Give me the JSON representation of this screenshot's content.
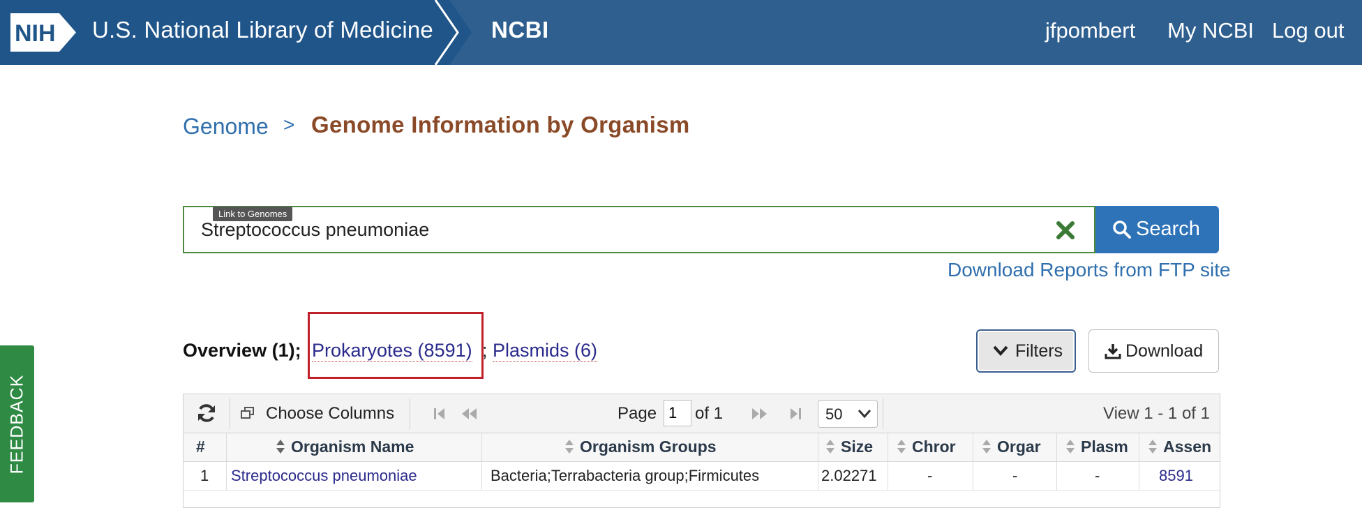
{
  "banner": {
    "nih_logo": "NIH",
    "nlm": "U.S. National Library of Medicine",
    "ncbi": "NCBI",
    "user": "jfpombert",
    "my_ncbi": "My NCBI",
    "logout": "Log out"
  },
  "breadcrumb": {
    "parent": "Genome",
    "separator": ">",
    "current": "Genome Information by Organism"
  },
  "search": {
    "value": "Streptococcus pneumoniae",
    "tooltip": "Link to Genomes",
    "button_label": "Search",
    "ftp_link": "Download Reports from FTP site"
  },
  "tabs": {
    "overview": "Overview (1);",
    "prokaryotes": "Prokaryotes (8591)",
    "sep": ";",
    "plasmids": "Plasmids (6)"
  },
  "actions": {
    "filters": "Filters",
    "download": "Download"
  },
  "toolbar": {
    "choose_columns": "Choose Columns",
    "page_label": "Page",
    "page_value": "1",
    "of_label": "of 1",
    "rows_per_page": "50",
    "view_range": "View 1 - 1 of 1"
  },
  "table": {
    "headers": {
      "num": "#",
      "organism_name": "Organism Name",
      "organism_groups": "Organism Groups",
      "size": "Size",
      "chromosomes": "Chror",
      "organelles": "Orgar",
      "plasmids": "Plasm",
      "assemblies": "Assen"
    },
    "rows": [
      {
        "num": "1",
        "organism_name": "Streptococcus pneumoniae",
        "organism_groups": "Bacteria;Terrabacteria group;Firmicutes",
        "size": "2.02271",
        "chromosomes": "-",
        "organelles": "-",
        "plasmids": "-",
        "assemblies": "8591"
      }
    ]
  },
  "feedback": "FEEDBACK",
  "colors": {
    "banner": "#20558a",
    "breadcrumb_title": "#8a4a28",
    "search_button": "#2e73b8",
    "highlight_box": "#c0202a",
    "feedback": "#2f8a44"
  }
}
